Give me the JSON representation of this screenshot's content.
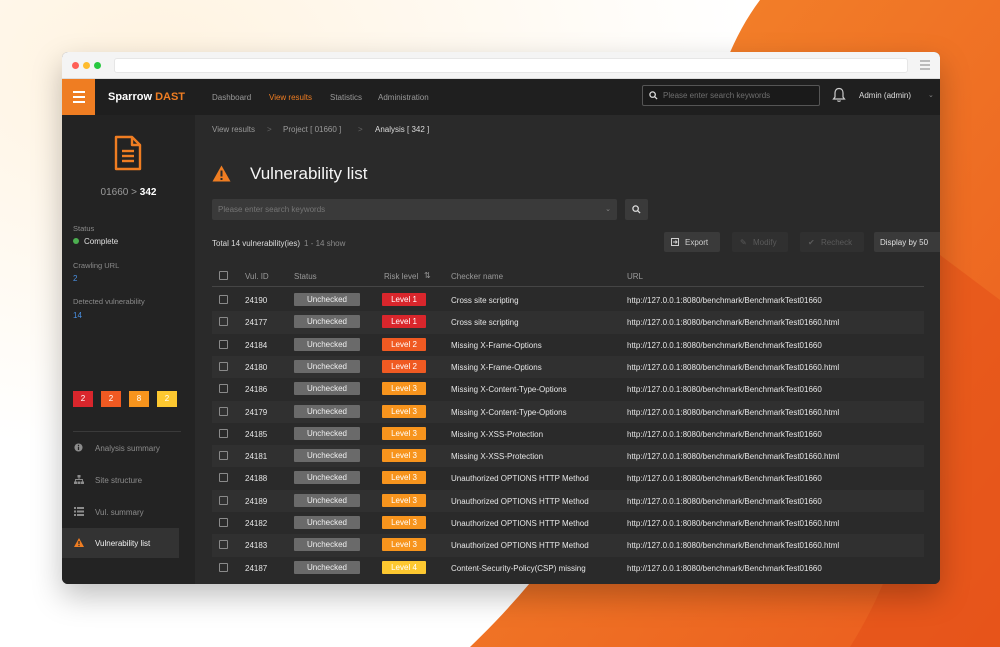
{
  "colors": {
    "accent": "#ef7d22",
    "level1": "#d9262c",
    "level2": "#f05a22",
    "level3": "#f7941d",
    "level4": "#fdc830"
  },
  "app": {
    "brand_main": "Sparrow",
    "brand_accent": "DAST",
    "nav": [
      "Dashboard",
      "View results",
      "Statistics",
      "Administration"
    ],
    "nav_active": "View results",
    "search_placeholder": "Please enter search keywords",
    "user": "Admin (admin)"
  },
  "sidebar": {
    "project_id": "01660",
    "arrow": ">",
    "analysis_id": "342",
    "status_label": "Status",
    "status_value": "Complete",
    "crawling_label": "Crawling URL",
    "crawling_value": "2",
    "detected_label": "Detected vulnerability",
    "detected_value": "14",
    "counts": [
      {
        "value": "2",
        "level": "level1"
      },
      {
        "value": "2",
        "level": "level2"
      },
      {
        "value": "8",
        "level": "level3"
      },
      {
        "value": "2",
        "level": "level4"
      }
    ],
    "menu": [
      {
        "label": "Analysis summary",
        "icon": "info-icon"
      },
      {
        "label": "Site structure",
        "icon": "sitemap-icon"
      },
      {
        "label": "Vul. summary",
        "icon": "list-icon"
      },
      {
        "label": "Vulnerability list",
        "icon": "warning-icon",
        "active": true
      }
    ]
  },
  "main": {
    "breadcrumb": [
      "View results",
      "Project [ 01660 ]",
      "Analysis [ 342 ]"
    ],
    "breadcrumb_sep": ">",
    "title": "Vulnerability list",
    "keyword_placeholder": "Please enter search keywords",
    "total_text": "Total 14 vulnerability(ies)",
    "range_text": "1 - 14 show",
    "buttons": {
      "export": "Export",
      "modify": "Modify",
      "recheck": "Recheck"
    },
    "display": "Display by 50",
    "columns": [
      "Vul. ID",
      "Status",
      "Risk level",
      "Checker name",
      "URL"
    ],
    "rows": [
      {
        "id": "24190",
        "status": "Unchecked",
        "level": "Level 1",
        "level_key": "level1",
        "checker": "Cross site scripting",
        "url": "http://127.0.0.1:8080/benchmark/BenchmarkTest01660"
      },
      {
        "id": "24177",
        "status": "Unchecked",
        "level": "Level 1",
        "level_key": "level1",
        "checker": "Cross site scripting",
        "url": "http://127.0.0.1:8080/benchmark/BenchmarkTest01660.html"
      },
      {
        "id": "24184",
        "status": "Unchecked",
        "level": "Level 2",
        "level_key": "level2",
        "checker": "Missing X-Frame-Options",
        "url": "http://127.0.0.1:8080/benchmark/BenchmarkTest01660"
      },
      {
        "id": "24180",
        "status": "Unchecked",
        "level": "Level 2",
        "level_key": "level2",
        "checker": "Missing X-Frame-Options",
        "url": "http://127.0.0.1:8080/benchmark/BenchmarkTest01660.html"
      },
      {
        "id": "24186",
        "status": "Unchecked",
        "level": "Level 3",
        "level_key": "level3",
        "checker": "Missing X-Content-Type-Options",
        "url": "http://127.0.0.1:8080/benchmark/BenchmarkTest01660"
      },
      {
        "id": "24179",
        "status": "Unchecked",
        "level": "Level 3",
        "level_key": "level3",
        "checker": "Missing X-Content-Type-Options",
        "url": "http://127.0.0.1:8080/benchmark/BenchmarkTest01660.html"
      },
      {
        "id": "24185",
        "status": "Unchecked",
        "level": "Level 3",
        "level_key": "level3",
        "checker": "Missing X-XSS-Protection",
        "url": "http://127.0.0.1:8080/benchmark/BenchmarkTest01660"
      },
      {
        "id": "24181",
        "status": "Unchecked",
        "level": "Level 3",
        "level_key": "level3",
        "checker": "Missing X-XSS-Protection",
        "url": "http://127.0.0.1:8080/benchmark/BenchmarkTest01660.html"
      },
      {
        "id": "24188",
        "status": "Unchecked",
        "level": "Level 3",
        "level_key": "level3",
        "checker": "Unauthorized OPTIONS HTTP Method",
        "url": "http://127.0.0.1:8080/benchmark/BenchmarkTest01660"
      },
      {
        "id": "24189",
        "status": "Unchecked",
        "level": "Level 3",
        "level_key": "level3",
        "checker": "Unauthorized OPTIONS HTTP Method",
        "url": "http://127.0.0.1:8080/benchmark/BenchmarkTest01660"
      },
      {
        "id": "24182",
        "status": "Unchecked",
        "level": "Level 3",
        "level_key": "level3",
        "checker": "Unauthorized OPTIONS HTTP Method",
        "url": "http://127.0.0.1:8080/benchmark/BenchmarkTest01660.html"
      },
      {
        "id": "24183",
        "status": "Unchecked",
        "level": "Level 3",
        "level_key": "level3",
        "checker": "Unauthorized OPTIONS HTTP Method",
        "url": "http://127.0.0.1:8080/benchmark/BenchmarkTest01660.html"
      },
      {
        "id": "24187",
        "status": "Unchecked",
        "level": "Level 4",
        "level_key": "level4",
        "checker": "Content-Security-Policy(CSP) missing",
        "url": "http://127.0.0.1:8080/benchmark/BenchmarkTest01660"
      }
    ]
  }
}
